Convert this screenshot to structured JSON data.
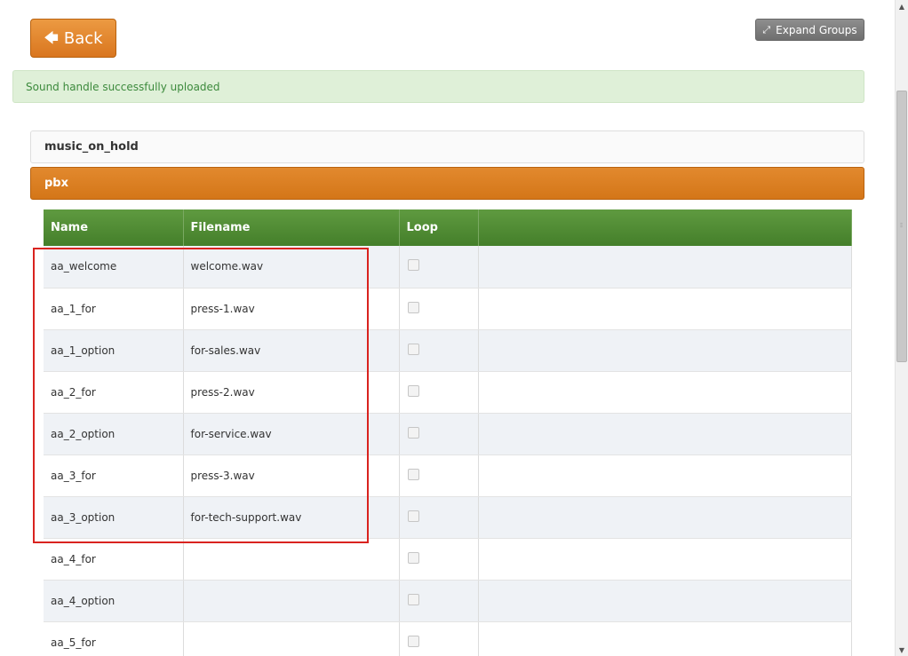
{
  "toolbar": {
    "back_label": "Back",
    "back_icon": "arrow-left-icon",
    "expand_label": "Expand Groups",
    "expand_icon": "expand-icon"
  },
  "alert": {
    "message": "Sound handle successfully uploaded"
  },
  "groups": [
    {
      "label": "music_on_hold",
      "expanded": false
    },
    {
      "label": "pbx",
      "expanded": true
    }
  ],
  "table": {
    "columns": [
      "Name",
      "Filename",
      "Loop",
      ""
    ],
    "rows": [
      {
        "name": "aa_welcome",
        "filename": "welcome.wav",
        "loop": false
      },
      {
        "name": "aa_1_for",
        "filename": "press-1.wav",
        "loop": false
      },
      {
        "name": "aa_1_option",
        "filename": "for-sales.wav",
        "loop": false
      },
      {
        "name": "aa_2_for",
        "filename": "press-2.wav",
        "loop": false
      },
      {
        "name": "aa_2_option",
        "filename": "for-service.wav",
        "loop": false
      },
      {
        "name": "aa_3_for",
        "filename": "press-3.wav",
        "loop": false
      },
      {
        "name": "aa_3_option",
        "filename": "for-tech-support.wav",
        "loop": false
      },
      {
        "name": "aa_4_for",
        "filename": "",
        "loop": false
      },
      {
        "name": "aa_4_option",
        "filename": "",
        "loop": false
      },
      {
        "name": "aa_5_for",
        "filename": "",
        "loop": false
      }
    ]
  },
  "colors": {
    "accent_orange": "#d9761f",
    "table_header_green": "#447f2a",
    "alert_green_bg": "#dff0d8",
    "highlight_red": "#d9231f"
  }
}
